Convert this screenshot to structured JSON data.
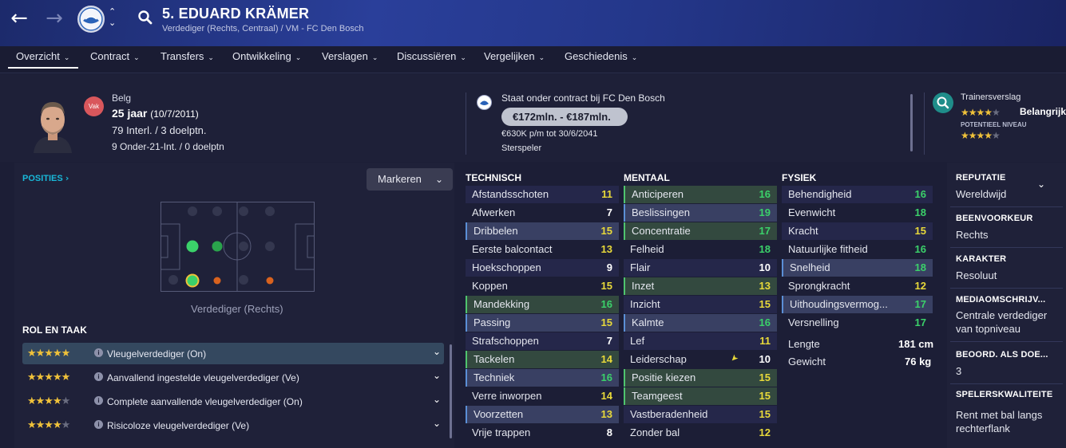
{
  "header": {
    "back_icon": "arrow-left-icon",
    "forward_icon": "arrow-right-icon",
    "name": "5. EDUARD KRÄMER",
    "subtitle": "Verdediger (Rechts, Centraal) / VM - FC Den Bosch"
  },
  "tabs": [
    {
      "label": "Overzicht"
    },
    {
      "label": "Contract"
    },
    {
      "label": "Transfers"
    },
    {
      "label": "Ontwikkeling"
    },
    {
      "label": "Verslagen"
    },
    {
      "label": "Discussiëren"
    },
    {
      "label": "Vergelijken"
    },
    {
      "label": "Geschiedenis"
    }
  ],
  "profile": {
    "badge": "Vak",
    "nationality": "Belg",
    "age": "25 jaar",
    "dob": "(10/7/2011)",
    "caps": "79 Interl. / 3 doelptn.",
    "u21": "9 Onder-21-Int. / 0 doelptn"
  },
  "contract": {
    "status": "Staat onder contract bij FC Den Bosch",
    "value": "€172mln. - €187mln.",
    "wage": "€630K p/m tot 30/6/2041",
    "role": "Sterspeler"
  },
  "coach": {
    "title": "Trainersverslag",
    "current_label": "Belangrijk",
    "potential_label": "POTENTIEEL NIVEAU",
    "current_stars": 4.5,
    "potential_stars": 4.5
  },
  "positions": {
    "title": "POSITIES",
    "button": "Markeren",
    "caption": "Verdediger (Rechts)"
  },
  "roles": {
    "title": "ROL EN TAAK",
    "items": [
      {
        "label": "Vleugelverdediger (On)",
        "stars": 5
      },
      {
        "label": "Aanvallend ingestelde vleugelverdediger (Ve)",
        "stars": 5
      },
      {
        "label": "Complete aanvallende vleugelverdediger (On)",
        "stars": 4.5
      },
      {
        "label": "Risicoloze vleugelverdediger (Ve)",
        "stars": 4.5
      }
    ]
  },
  "attributes": {
    "technisch": {
      "title": "TECHNISCH",
      "rows": [
        {
          "name": "Afstandsschoten",
          "value": "11"
        },
        {
          "name": "Afwerken",
          "value": "7"
        },
        {
          "name": "Dribbelen",
          "value": "15"
        },
        {
          "name": "Eerste balcontact",
          "value": "13"
        },
        {
          "name": "Hoekschoppen",
          "value": "9"
        },
        {
          "name": "Koppen",
          "value": "15"
        },
        {
          "name": "Mandekking",
          "value": "16"
        },
        {
          "name": "Passing",
          "value": "15"
        },
        {
          "name": "Strafschoppen",
          "value": "7"
        },
        {
          "name": "Tackelen",
          "value": "14"
        },
        {
          "name": "Techniek",
          "value": "16"
        },
        {
          "name": "Verre inworpen",
          "value": "14"
        },
        {
          "name": "Voorzetten",
          "value": "13"
        },
        {
          "name": "Vrije trappen",
          "value": "8"
        }
      ]
    },
    "mentaal": {
      "title": "MENTAAL",
      "rows": [
        {
          "name": "Anticiperen",
          "value": "16"
        },
        {
          "name": "Beslissingen",
          "value": "19"
        },
        {
          "name": "Concentratie",
          "value": "17"
        },
        {
          "name": "Felheid",
          "value": "18"
        },
        {
          "name": "Flair",
          "value": "10"
        },
        {
          "name": "Inzet",
          "value": "13"
        },
        {
          "name": "Inzicht",
          "value": "15"
        },
        {
          "name": "Kalmte",
          "value": "16"
        },
        {
          "name": "Lef",
          "value": "11"
        },
        {
          "name": "Leiderschap",
          "value": "10"
        },
        {
          "name": "Positie kiezen",
          "value": "15"
        },
        {
          "name": "Teamgeest",
          "value": "15"
        },
        {
          "name": "Vastberadenheid",
          "value": "15"
        },
        {
          "name": "Zonder bal",
          "value": "12"
        }
      ]
    },
    "fysiek": {
      "title": "FYSIEK",
      "rows": [
        {
          "name": "Behendigheid",
          "value": "16"
        },
        {
          "name": "Evenwicht",
          "value": "18"
        },
        {
          "name": "Kracht",
          "value": "15"
        },
        {
          "name": "Natuurlijke fitheid",
          "value": "16"
        },
        {
          "name": "Snelheid",
          "value": "18"
        },
        {
          "name": "Sprongkracht",
          "value": "12"
        },
        {
          "name": "Uithoudingsvermog...",
          "value": "17"
        },
        {
          "name": "Versnelling",
          "value": "17"
        }
      ]
    },
    "physical_info": [
      {
        "name": "Lengte",
        "value": "181 cm"
      },
      {
        "name": "Gewicht",
        "value": "76 kg"
      }
    ]
  },
  "sidebar": [
    {
      "title": "REPUTATIE",
      "value": "Wereldwijd"
    },
    {
      "title": "BEENVOORKEUR",
      "value": "Rechts"
    },
    {
      "title": "KARAKTER",
      "value": "Resoluut"
    },
    {
      "title": "MEDIAOMSCHRIJV...",
      "value": "Centrale verdediger van topniveau"
    },
    {
      "title": "BEOORD. ALS DOE...",
      "value": "3"
    },
    {
      "title": "SPELERSKWALITEITE",
      "value": "Rent met bal langs rechterflank"
    }
  ],
  "colors": {
    "green": "#3bd16a",
    "yellow": "#e8d93a",
    "white": "#ffffff",
    "highlight_blue": "#394063",
    "highlight_green": "#33493f",
    "accent": "#19b8d8"
  }
}
